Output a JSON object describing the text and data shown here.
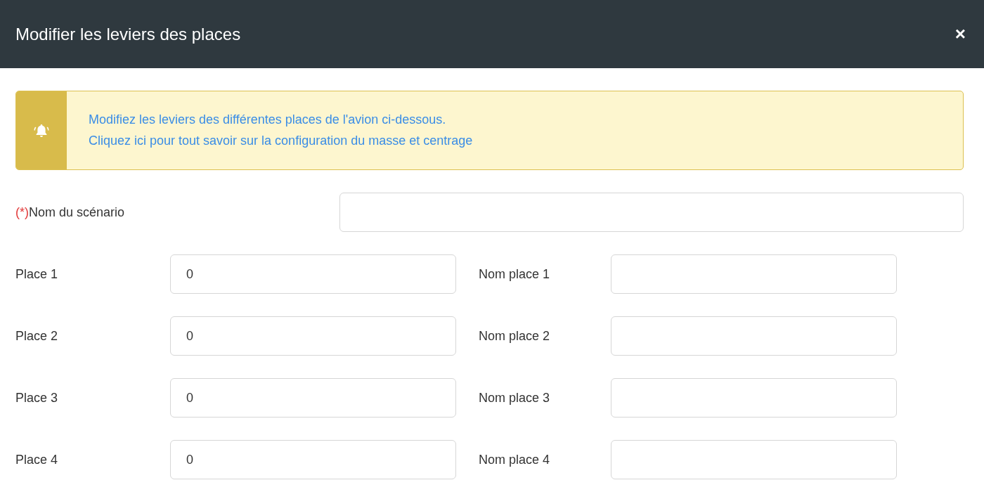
{
  "dialog": {
    "title": "Modifier les leviers des places",
    "close": "×"
  },
  "alert": {
    "message": "Modifiez les leviers des différentes places de l'avion ci-dessous.",
    "link": "Cliquez ici pour tout savoir sur la configuration du masse et centrage"
  },
  "scenario": {
    "required_mark": "(*)",
    "label": "Nom du scénario"
  },
  "places": [
    {
      "label": "Place 1",
      "value": "0",
      "name_label": "Nom place 1"
    },
    {
      "label": "Place 2",
      "value": "0",
      "name_label": "Nom place 2"
    },
    {
      "label": "Place 3",
      "value": "0",
      "name_label": "Nom place 3"
    },
    {
      "label": "Place 4",
      "value": "0",
      "name_label": "Nom place 4"
    }
  ]
}
